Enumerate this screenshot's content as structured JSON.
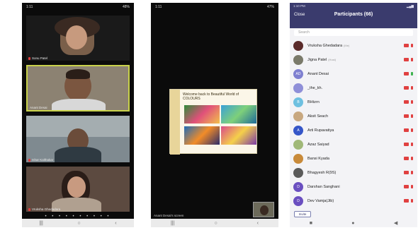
{
  "phone1": {
    "status_left": "1:11",
    "status_right": "48%",
    "tiles": [
      {
        "name": "Sonu Patel",
        "bg": "#7a6a5a"
      },
      {
        "name": "Anant Desai",
        "bg": "#a69a86"
      },
      {
        "name": "Ishar Kalthakar",
        "bg": "#8a8f95"
      },
      {
        "name": "Vruksha Ghedadara",
        "bg": "#6d5b4c"
      }
    ],
    "page_dots": "• • • • • • • • • •"
  },
  "phone2": {
    "status_left": "1:11",
    "status_right": "47%",
    "slide_title": "Welcome back to Beautiful World of COLOURS",
    "screen_label": "Anant Desai's screen"
  },
  "phone3": {
    "status_left": "1:10 PM",
    "close_label": "Close",
    "title": "Participants (66)",
    "search_placeholder": "Search",
    "invite_label": "Invite",
    "participants": [
      {
        "name": "Vruksha Ghedadara",
        "tag": "(Me)",
        "avatar_text": "",
        "avatar_color": "#5a2a2a",
        "mic": "red"
      },
      {
        "name": "Jigna Patel",
        "tag": "(Host)",
        "avatar_text": "",
        "avatar_color": "#7a7a6a",
        "mic": "red"
      },
      {
        "name": "Anant Desai",
        "tag": "",
        "avatar_text": "AD",
        "avatar_color": "#7e7fd0",
        "mic": "green"
      },
      {
        "name": "_the_kh.",
        "tag": "",
        "avatar_text": "",
        "avatar_color": "#8f8fd8",
        "mic": "red"
      },
      {
        "name": "BHtzrn",
        "tag": "",
        "avatar_text": "B",
        "avatar_color": "#6ec0e0",
        "mic": "red"
      },
      {
        "name": "Aksit Seach",
        "tag": "",
        "avatar_text": "",
        "avatar_color": "#c8a880",
        "mic": "red"
      },
      {
        "name": "Arti Rupavatiya",
        "tag": "",
        "avatar_text": "A",
        "avatar_color": "#3556c8",
        "mic": "red"
      },
      {
        "name": "Azaz Saiyad",
        "tag": "",
        "avatar_text": "",
        "avatar_color": "#a0b878",
        "mic": "red"
      },
      {
        "name": "Bansi Kyada",
        "tag": "",
        "avatar_text": "",
        "avatar_color": "#c88a3a",
        "mic": "red"
      },
      {
        "name": "Bhagyesh R(9S)",
        "tag": "",
        "avatar_text": "",
        "avatar_color": "#5a5a5a",
        "mic": "red"
      },
      {
        "name": "Darshan Sanghani",
        "tag": "",
        "avatar_text": "D",
        "avatar_color": "#6a4fc0",
        "mic": "red"
      },
      {
        "name": "Dev Vamja(Jib)",
        "tag": "",
        "avatar_text": "D",
        "avatar_color": "#6a4fc0",
        "mic": "red"
      }
    ]
  },
  "nav_glyphs": {
    "recent": "|||",
    "home": "○",
    "back": "‹"
  }
}
